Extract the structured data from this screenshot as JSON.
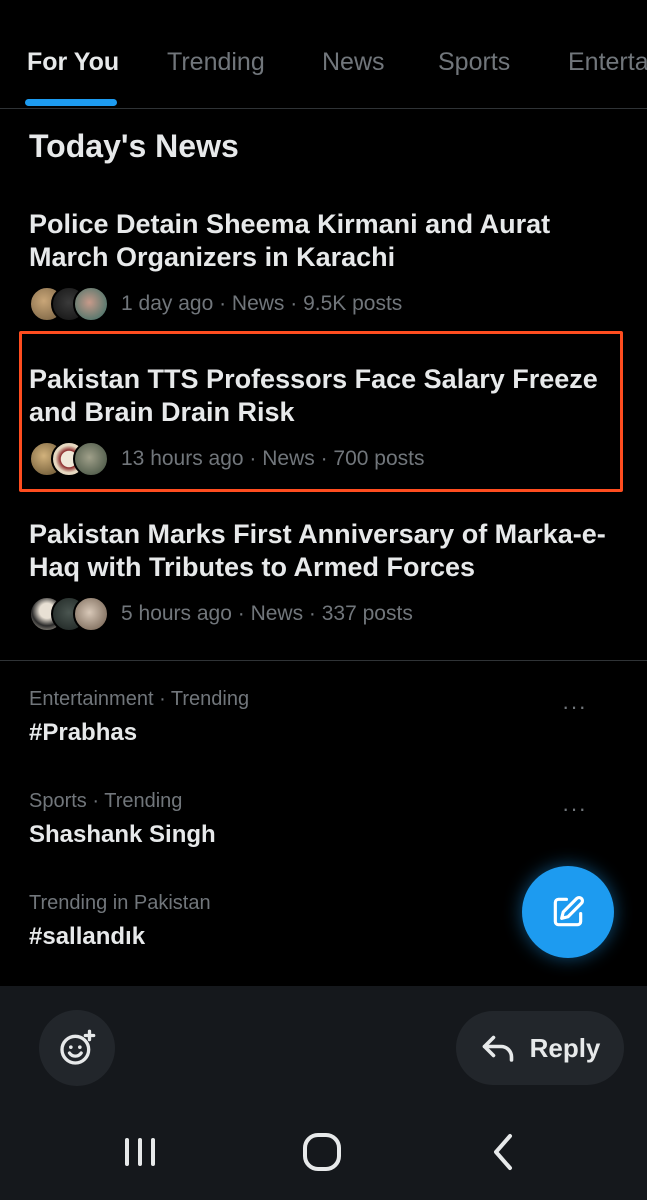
{
  "tabs": [
    {
      "label": "For You",
      "active": true
    },
    {
      "label": "Trending",
      "active": false
    },
    {
      "label": "News",
      "active": false
    },
    {
      "label": "Sports",
      "active": false
    },
    {
      "label": "Enterta",
      "active": false
    }
  ],
  "section_title": "Today's News",
  "stories": [
    {
      "title": "Police Detain Sheema Kirmani and Aurat March Organizers in Karachi",
      "meta": "1 day ago · News · 9.5K posts"
    },
    {
      "title": "Pakistan TTS Professors Face Salary Freeze and Brain Drain Risk",
      "meta": "13 hours ago · News · 700 posts"
    },
    {
      "title": "Pakistan Marks First Anniversary of Marka-e-Haq with Tributes to Armed Forces",
      "meta": "5 hours ago · News · 337 posts"
    }
  ],
  "trends": [
    {
      "category": "Entertainment · Trending",
      "name": "#Prabhas",
      "more": "···"
    },
    {
      "category": "Sports · Trending",
      "name": "Shashank Singh",
      "more": "···"
    },
    {
      "category": "Trending in Pakistan",
      "name": "#sallandık"
    }
  ],
  "reply_label": "Reply",
  "colors": {
    "accent": "#1d9bf0",
    "highlight": "#ff4d1f",
    "muted": "#71767b"
  },
  "icons": {
    "fab": "compose-icon",
    "emoji": "emoji-add-icon",
    "reply": "reply-arrow-icon",
    "nav": [
      "recent-apps-icon",
      "home-icon",
      "back-icon"
    ]
  }
}
